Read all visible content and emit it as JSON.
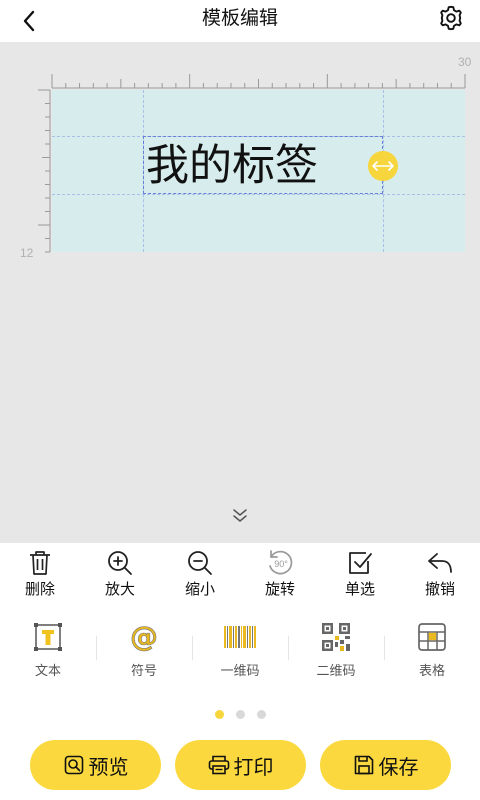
{
  "header": {
    "title": "模板编辑",
    "back_icon": "chevron-left-icon",
    "settings_icon": "gear-icon"
  },
  "canvas": {
    "ruler_top_max": "30",
    "ruler_left_max": "12",
    "label_text": "我的标签",
    "label_background_color": "#d7ecec",
    "handle_color": "#f7d63d"
  },
  "toolbar": {
    "items": [
      {
        "label": "删除",
        "icon": "trash-icon"
      },
      {
        "label": "放大",
        "icon": "zoom-in-icon"
      },
      {
        "label": "缩小",
        "icon": "zoom-out-icon"
      },
      {
        "label": "旋转",
        "icon": "rotate-90-icon"
      },
      {
        "label": "单选",
        "icon": "checkbox-icon"
      },
      {
        "label": "撤销",
        "icon": "undo-icon"
      }
    ]
  },
  "elements": {
    "items": [
      {
        "label": "文本",
        "icon": "text-icon"
      },
      {
        "label": "符号",
        "icon": "at-symbol-icon"
      },
      {
        "label": "一维码",
        "icon": "barcode-icon"
      },
      {
        "label": "二维码",
        "icon": "qrcode-icon"
      },
      {
        "label": "表格",
        "icon": "table-icon"
      }
    ]
  },
  "pager": {
    "pages": 3,
    "active": 1
  },
  "actions": {
    "preview_label": "预览",
    "print_label": "打印",
    "save_label": "保存"
  },
  "accent_color": "#fbd93e"
}
